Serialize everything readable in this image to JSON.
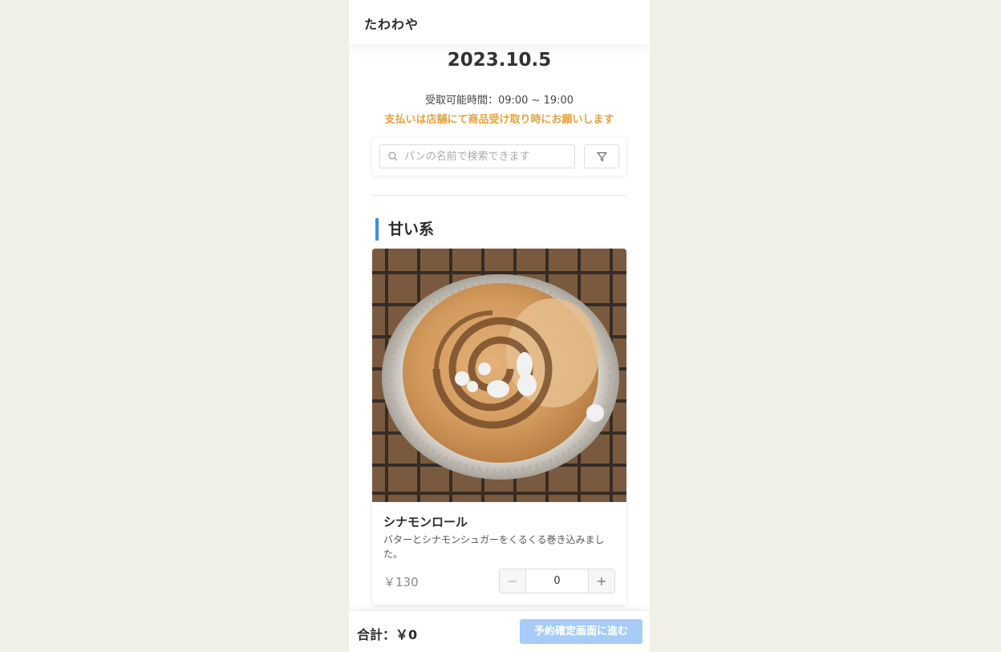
{
  "header": {
    "shop_name": "たわわや"
  },
  "order": {
    "date": "2023.10.5",
    "pickup_time": "受取可能時間：09:00 ~ 19:00",
    "payment_note": "支払いは店舗にて商品受け取り時にお願いします"
  },
  "search": {
    "placeholder": "パンの名前で検索できます",
    "value": ""
  },
  "icons": {
    "search": "search-icon",
    "filter": "filter-icon"
  },
  "section": {
    "title": "甘い系",
    "accent_color": "#3d8ee8"
  },
  "products": [
    {
      "name": "シナモンロール",
      "description": "バターとシナモンシュガーをくるくる巻き込みました。",
      "price": "￥130",
      "quantity": "0",
      "minus_label": "−",
      "plus_label": "+"
    }
  ],
  "footer": {
    "total": "合計：￥0",
    "proceed_label": "予約確定画面に進む",
    "proceed_color": "#a7cdf6"
  },
  "colors": {
    "note": "#e8a23a",
    "background": "#f0efe8"
  }
}
